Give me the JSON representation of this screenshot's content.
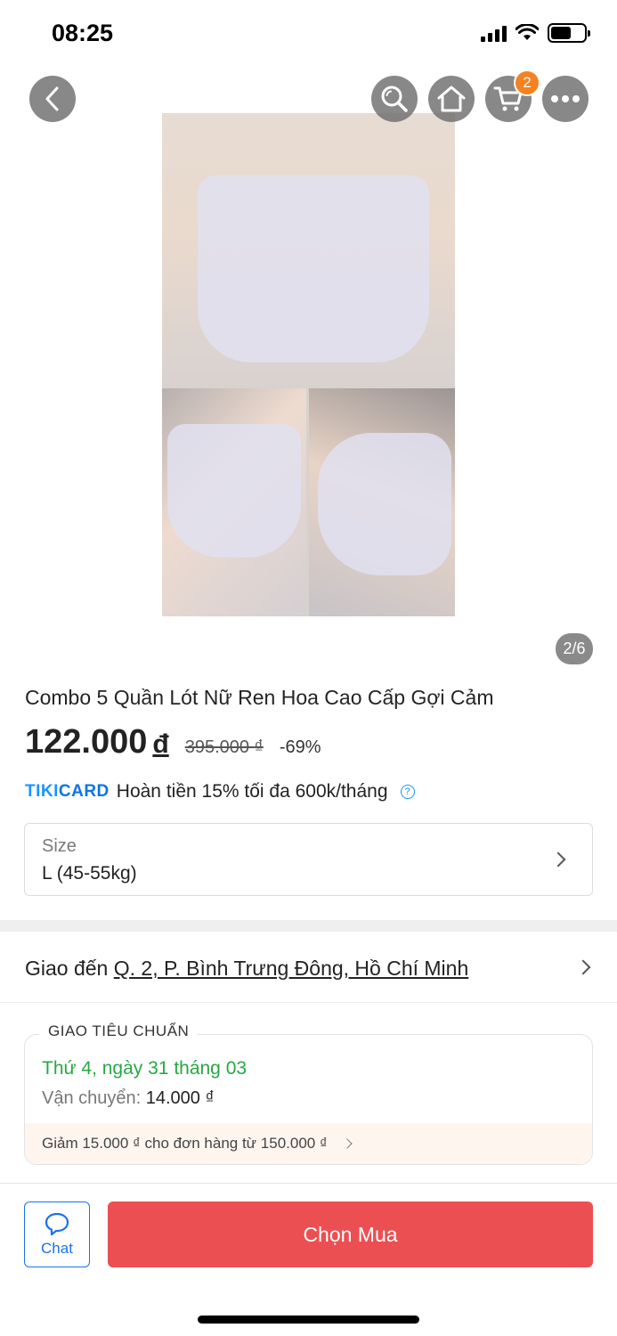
{
  "status_bar": {
    "time": "08:25"
  },
  "nav": {
    "cart_count": "2"
  },
  "gallery": {
    "indicator": "2/6"
  },
  "product": {
    "title": "Combo 5 Quần Lót Nữ Ren Hoa Cao Cấp Gợi Cảm",
    "price": "122.000",
    "currency": "đ",
    "old_price": "395.000 ₫",
    "discount": "-69%"
  },
  "tikicard": {
    "logo_tiki": "TIKI",
    "logo_card": "CARD",
    "text": "Hoàn tiền 15% tối đa 600k/tháng",
    "help": "?"
  },
  "size": {
    "label": "Size",
    "value": "L (45-55kg)"
  },
  "delivery": {
    "prefix": "Giao đến ",
    "address": "Q. 2, P. Bình Trưng Đông, Hồ Chí Minh"
  },
  "shipping": {
    "tag": "GIAO TIÊU CHUẨN",
    "date": "Thứ 4, ngày 31 tháng 03",
    "fee_label": "Vận chuyển: ",
    "fee_value": "14.000 ₫",
    "promo": "Giảm 15.000 ₫ cho đơn hàng từ 150.000 ₫"
  },
  "actions": {
    "chat": "Chat",
    "buy": "Chọn Mua"
  },
  "colors": {
    "accent_blue": "#1a73e8",
    "buy_red": "#ec4f52",
    "delivery_green": "#27a844",
    "badge_orange": "#f58220"
  }
}
